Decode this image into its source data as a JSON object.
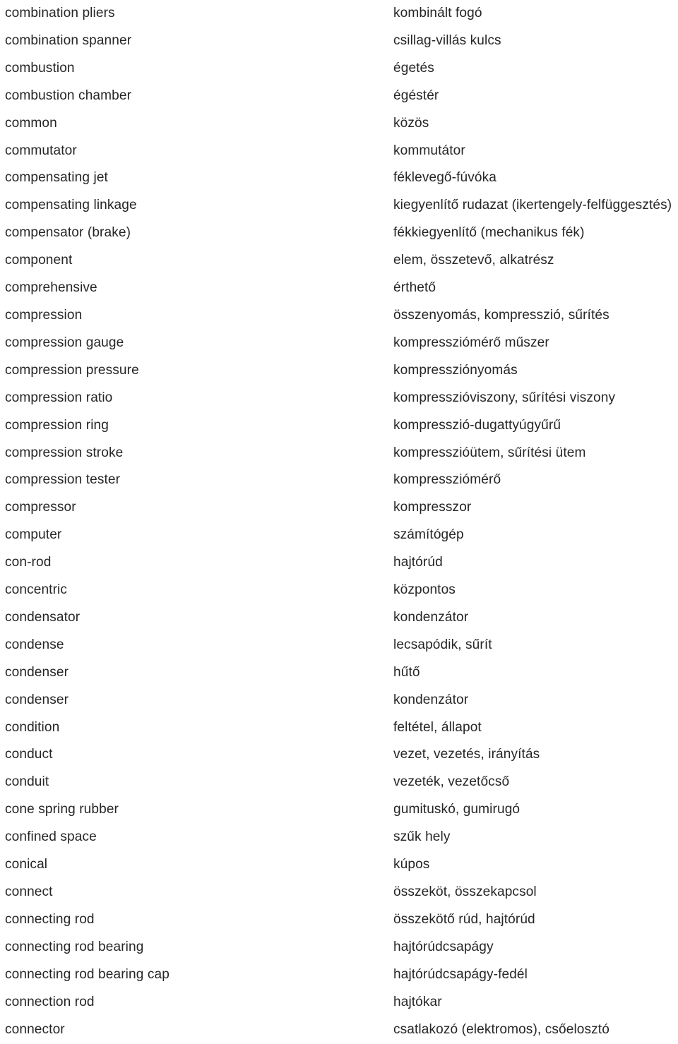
{
  "document": {
    "type": "bilingual-glossary",
    "source_language": "English",
    "target_language": "Hungarian",
    "entry_count": 38
  },
  "entries": [
    {
      "source": "combination pliers",
      "target": "kombinált fogó"
    },
    {
      "source": "combination spanner",
      "target": "csillag-villás kulcs"
    },
    {
      "source": "combustion",
      "target": "égetés"
    },
    {
      "source": "combustion chamber",
      "target": "égéstér"
    },
    {
      "source": "common",
      "target": "közös"
    },
    {
      "source": "commutator",
      "target": "kommutátor"
    },
    {
      "source": "compensating jet",
      "target": "féklevegő-fúvóka"
    },
    {
      "source": "compensating linkage",
      "target": "kiegyenlítő rudazat (ikertengely-felfüggesztés)"
    },
    {
      "source": "compensator (brake)",
      "target": "fékkiegyenlítő (mechanikus fék)"
    },
    {
      "source": "component",
      "target": "elem, összetevő, alkatrész"
    },
    {
      "source": "comprehensive",
      "target": "érthető"
    },
    {
      "source": "compression",
      "target": "összenyomás, kompresszió, sűrítés"
    },
    {
      "source": "compression gauge",
      "target": "kompressziómérő műszer"
    },
    {
      "source": "compression pressure",
      "target": "kompressziónyomás"
    },
    {
      "source": "compression ratio",
      "target": "kompresszióviszony, sűrítési viszony"
    },
    {
      "source": "compression ring",
      "target": "kompresszió-dugattyúgyűrű"
    },
    {
      "source": "compression stroke",
      "target": "kompresszióütem, sűrítési ütem"
    },
    {
      "source": "compression tester",
      "target": "kompressziómérő"
    },
    {
      "source": "compressor",
      "target": "kompresszor"
    },
    {
      "source": "computer",
      "target": "számítógép"
    },
    {
      "source": "con-rod",
      "target": "hajtórúd"
    },
    {
      "source": "concentric",
      "target": "központos"
    },
    {
      "source": "condensator",
      "target": "kondenzátor"
    },
    {
      "source": "condense",
      "target": "lecsapódik, sűrít"
    },
    {
      "source": "condenser",
      "target": "hűtő"
    },
    {
      "source": "condenser",
      "target": "kondenzátor"
    },
    {
      "source": "condition",
      "target": "feltétel, állapot"
    },
    {
      "source": "conduct",
      "target": "vezet, vezetés, irányítás"
    },
    {
      "source": "conduit",
      "target": "vezeték, vezetőcső"
    },
    {
      "source": "cone spring rubber",
      "target": "gumituskó, gumirugó"
    },
    {
      "source": "confined space",
      "target": "szűk hely"
    },
    {
      "source": "conical",
      "target": "kúpos"
    },
    {
      "source": "connect",
      "target": "összeköt, összekapcsol"
    },
    {
      "source": "connecting rod",
      "target": "összekötő rúd, hajtórúd"
    },
    {
      "source": "connecting rod bearing",
      "target": "hajtórúdcsapágy"
    },
    {
      "source": "connecting rod bearing cap",
      "target": "hajtórúdcsapágy-fedél"
    },
    {
      "source": "connection rod",
      "target": "hajtókar"
    },
    {
      "source": "connector",
      "target": "csatlakozó (elektromos), csőelosztó"
    }
  ],
  "style": {
    "text_color": "#262626",
    "background_color": "#ffffff"
  }
}
